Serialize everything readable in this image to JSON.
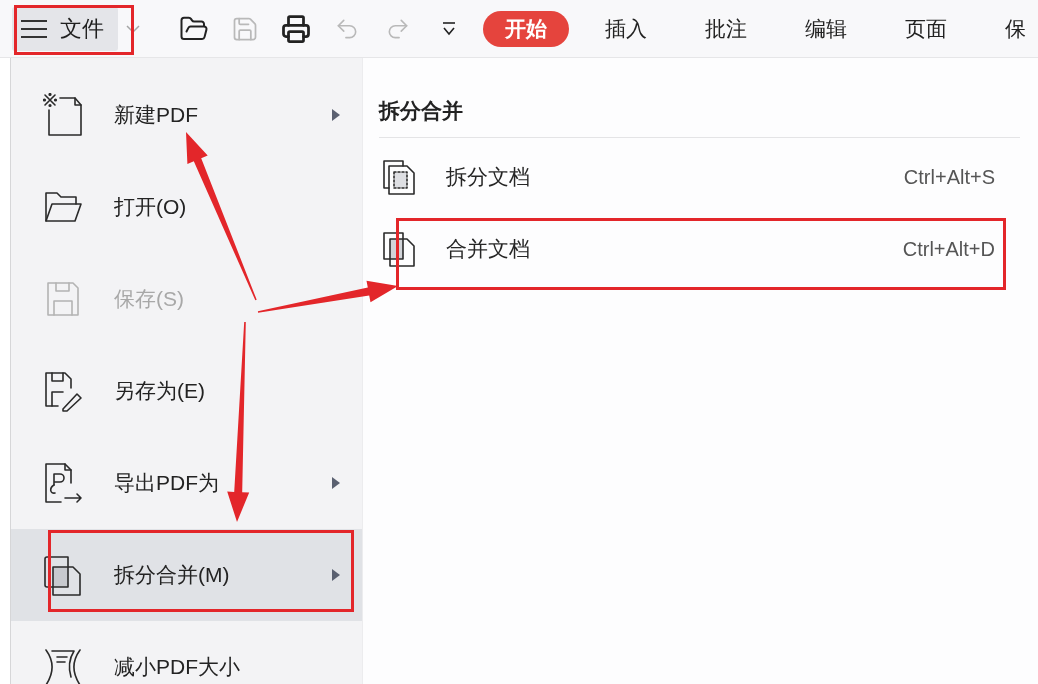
{
  "toolbar": {
    "file_button": {
      "label": "文件",
      "annotated": true
    },
    "quick_tools": [
      {
        "kind": "open",
        "disabled": false
      },
      {
        "kind": "save",
        "disabled": true
      },
      {
        "kind": "print",
        "disabled": false
      },
      {
        "kind": "undo",
        "disabled": true
      },
      {
        "kind": "redo",
        "disabled": true
      },
      {
        "kind": "customize",
        "disabled": false
      }
    ],
    "tabs": [
      {
        "label": "开始",
        "selected": true
      },
      {
        "label": "插入",
        "selected": false
      },
      {
        "label": "批注",
        "selected": false
      },
      {
        "label": "编辑",
        "selected": false
      },
      {
        "label": "页面",
        "selected": false
      },
      {
        "label": "保",
        "selected": false
      }
    ]
  },
  "file_menu": {
    "items": [
      {
        "label": "新建PDF",
        "kind": "new",
        "submenu": true,
        "disabled": false,
        "selected": false,
        "annotated": false
      },
      {
        "label": "打开(O)",
        "kind": "open",
        "submenu": false,
        "disabled": false,
        "selected": false,
        "annotated": false
      },
      {
        "label": "保存(S)",
        "kind": "save",
        "submenu": false,
        "disabled": true,
        "selected": false,
        "annotated": false
      },
      {
        "label": "另存为(E)",
        "kind": "save_as",
        "submenu": false,
        "disabled": false,
        "selected": false,
        "annotated": false
      },
      {
        "label": "导出PDF为",
        "kind": "export",
        "submenu": true,
        "disabled": false,
        "selected": false,
        "annotated": false
      },
      {
        "label": "拆分合并(M)",
        "kind": "split_merge",
        "submenu": true,
        "disabled": false,
        "selected": true,
        "annotated": true
      },
      {
        "label": "减小PDF大小",
        "kind": "compress",
        "submenu": false,
        "disabled": false,
        "selected": false,
        "annotated": false
      }
    ]
  },
  "submenu": {
    "title": "拆分合并",
    "items": [
      {
        "label": "拆分文档",
        "shortcut": "Ctrl+Alt+S",
        "kind": "split",
        "annotated": false
      },
      {
        "label": "合并文档",
        "shortcut": "Ctrl+Alt+D",
        "kind": "merge",
        "annotated": true
      }
    ]
  },
  "annotation_arrows": [
    {
      "kind": "up_left"
    },
    {
      "kind": "right"
    },
    {
      "kind": "down"
    }
  ]
}
